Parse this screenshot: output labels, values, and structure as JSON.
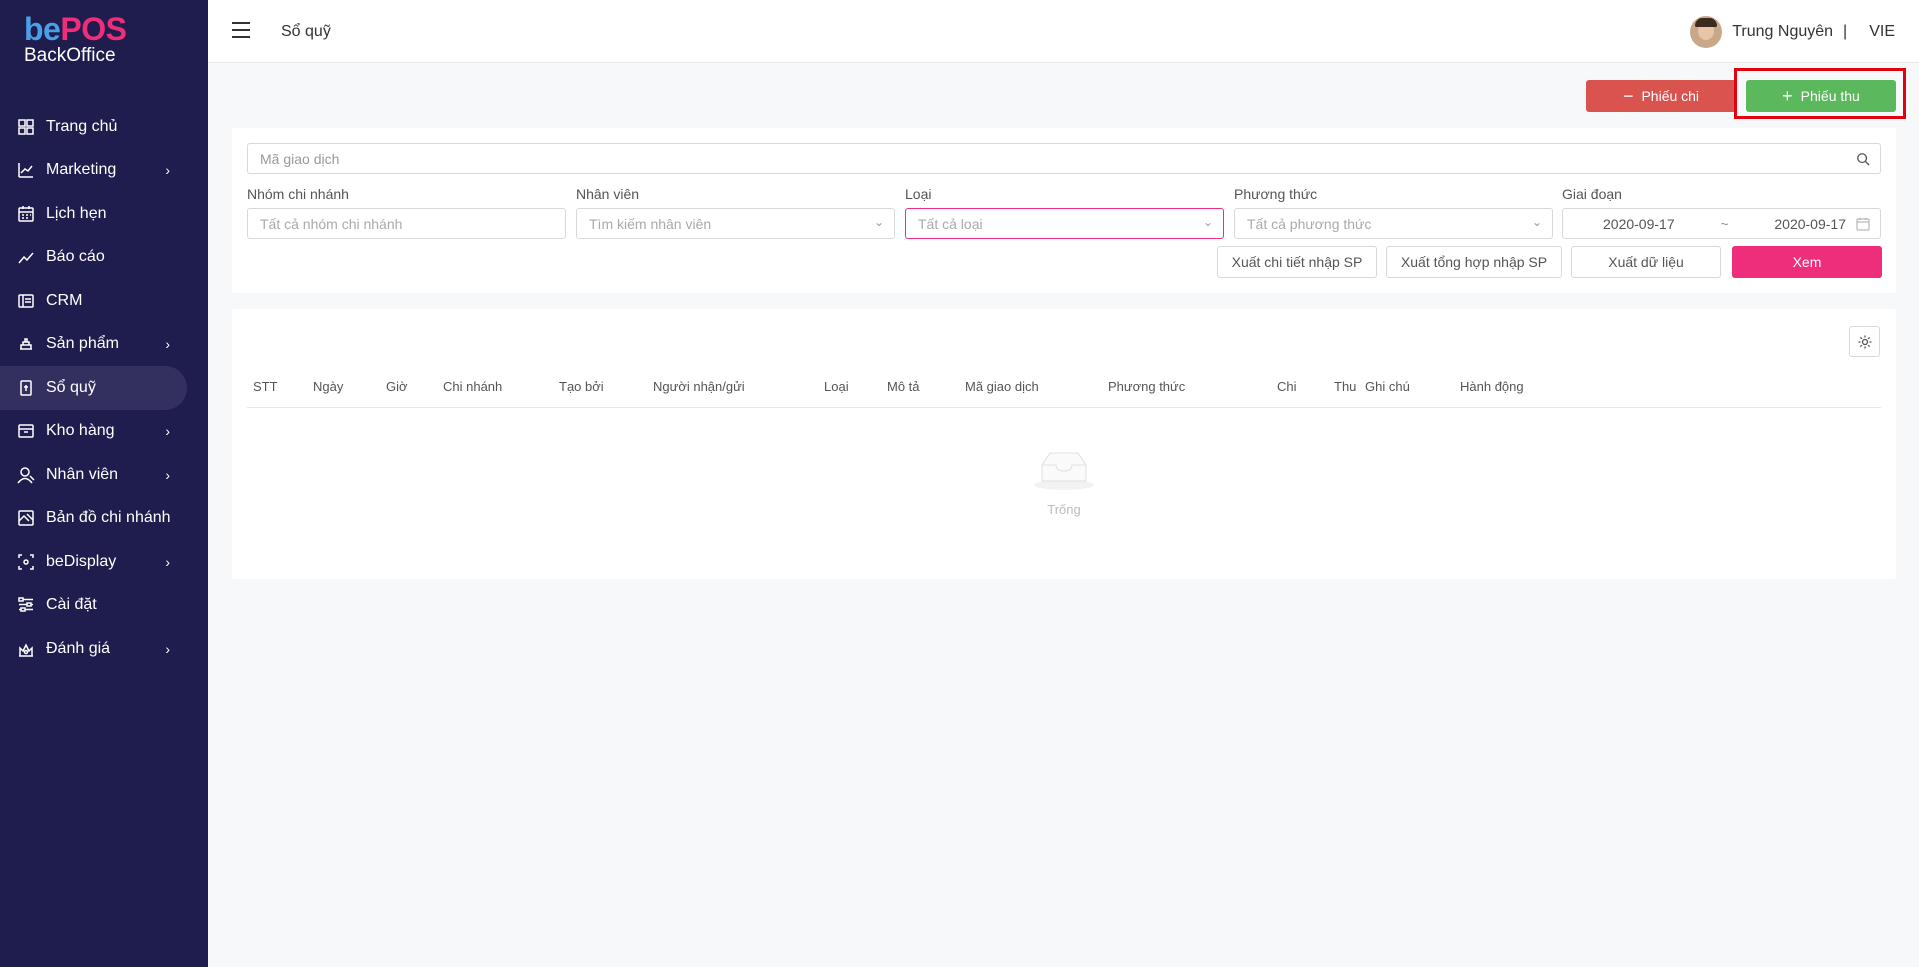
{
  "brand": {
    "part1": "be",
    "part2": "POS",
    "sub": "BackOffice"
  },
  "sidebar": {
    "items": [
      {
        "label": "Trang chủ",
        "icon": "grid-icon",
        "chevron": false
      },
      {
        "label": "Marketing",
        "icon": "chart-line-icon",
        "chevron": true
      },
      {
        "label": "Lịch hẹn",
        "icon": "calendar-icon",
        "chevron": false
      },
      {
        "label": "Báo cáo",
        "icon": "trend-icon",
        "chevron": false
      },
      {
        "label": "CRM",
        "icon": "crm-icon",
        "chevron": false
      },
      {
        "label": "Sản phẩm",
        "icon": "product-icon",
        "chevron": true
      },
      {
        "label": "Sổ quỹ",
        "icon": "cashbook-icon",
        "chevron": false,
        "active": true
      },
      {
        "label": "Kho hàng",
        "icon": "warehouse-icon",
        "chevron": true
      },
      {
        "label": "Nhân viên",
        "icon": "user-icon",
        "chevron": true
      },
      {
        "label": "Bản đồ chi nhánh",
        "icon": "map-icon",
        "chevron": false
      },
      {
        "label": "beDisplay",
        "icon": "display-icon",
        "chevron": true
      },
      {
        "label": "Cài đặt",
        "icon": "settings-sliders-icon",
        "chevron": false
      },
      {
        "label": "Đánh giá",
        "icon": "rating-icon",
        "chevron": true
      }
    ]
  },
  "header": {
    "title": "Sổ quỹ",
    "user_name": "Trung Nguyên",
    "separator": "|",
    "language": "VIE"
  },
  "actions": {
    "chi_label": "Phiếu chi",
    "thu_label": "Phiếu thu",
    "minus": "−",
    "plus": "+"
  },
  "filters": {
    "search_placeholder": "Mã giao dịch",
    "branch_group": {
      "label": "Nhóm chi nhánh",
      "placeholder": "Tất cả nhóm chi nhánh"
    },
    "employee": {
      "label": "Nhân viên",
      "placeholder": "Tìm kiếm nhân viên"
    },
    "type": {
      "label": "Loại",
      "placeholder": "Tất cả loại"
    },
    "method": {
      "label": "Phương thức",
      "placeholder": "Tất cả phương thức"
    },
    "period": {
      "label": "Giai đoạn",
      "from": "2020-09-17",
      "separator": "~",
      "to": "2020-09-17"
    },
    "buttons": {
      "export_detail": "Xuất chi tiết nhập SP",
      "export_summary": "Xuất tổng hợp nhập SP",
      "export_data": "Xuất dữ liệu",
      "view": "Xem"
    }
  },
  "table": {
    "columns": [
      "STT",
      "Ngày",
      "Giờ",
      "Chi nhánh",
      "Tạo bởi",
      "Người nhận/gửi",
      "Loại",
      "Mô tả",
      "Mã giao dịch",
      "Phương thức",
      "Chi",
      "Thu",
      "Ghi chú",
      "Hành động"
    ],
    "empty_text": "Trống"
  },
  "colors": {
    "sidebar_bg": "#1f1d4d",
    "accent_pink": "#ee2e7a",
    "btn_red": "#d9534f",
    "btn_green": "#5cb85c",
    "highlight": "#e3000f"
  }
}
